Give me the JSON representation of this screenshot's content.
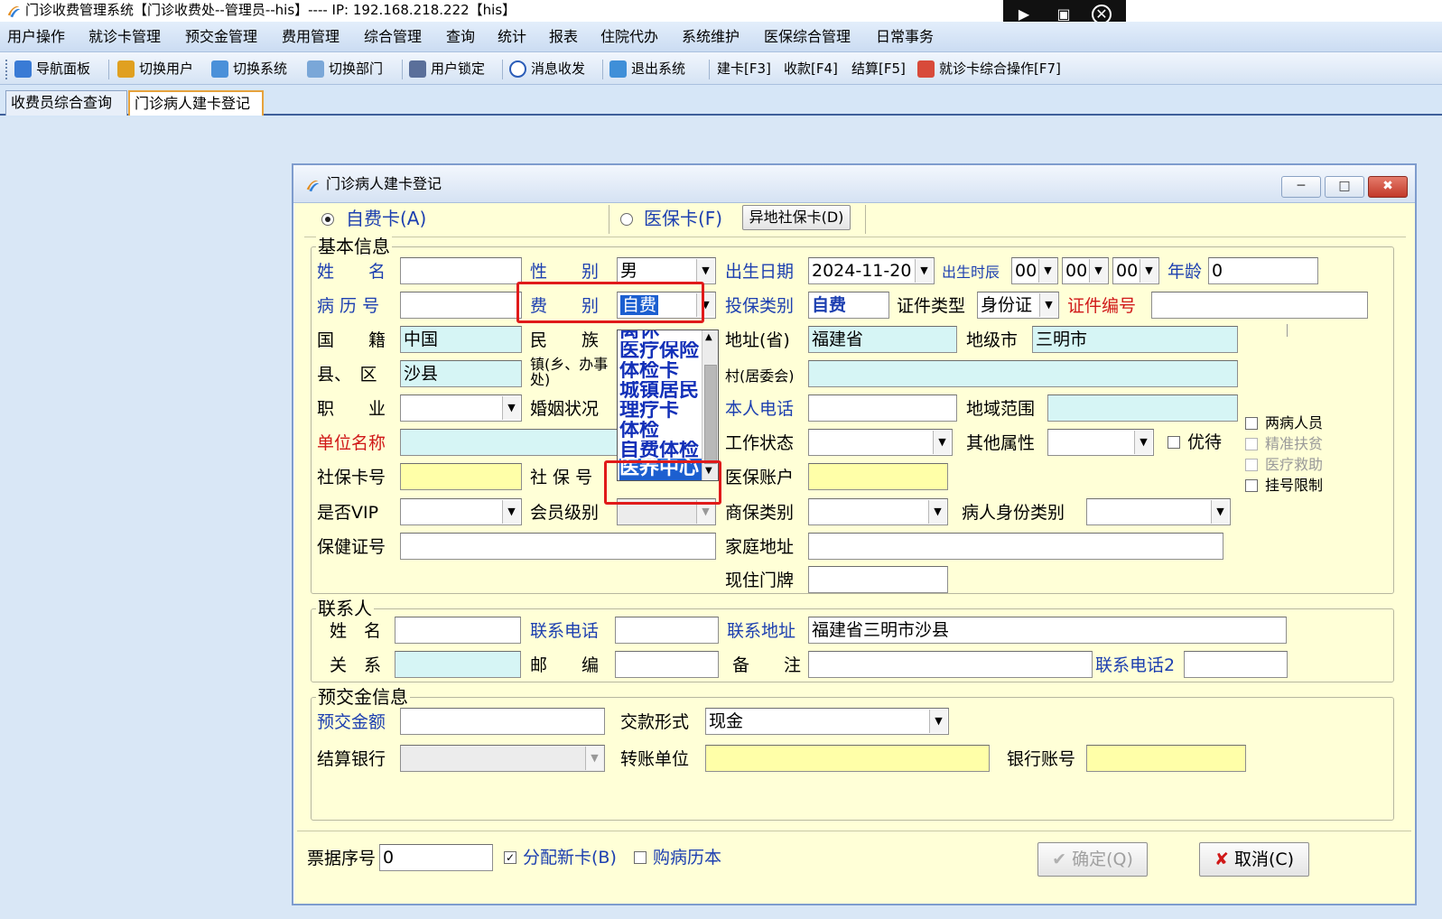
{
  "window": {
    "title": "门诊收费管理系统【门诊收费处--管理员--his】---- IP: 192.168.218.222【his】"
  },
  "menu": [
    "用户操作",
    "就诊卡管理",
    "预交金管理",
    "费用管理",
    "综合管理",
    "查询",
    "统计",
    "报表",
    "住院代办",
    "系统维护",
    "医保综合管理",
    "日常事务"
  ],
  "toolbar": {
    "nav": "导航面板",
    "switch_user": "切换用户",
    "switch_system": "切换系统",
    "switch_dept": "切换部门",
    "lock_user": "用户锁定",
    "messages": "消息收发",
    "exit": "退出系统",
    "f3": "建卡[F3]",
    "f4": "收款[F4]",
    "f5": "结算[F5]",
    "f7": "就诊卡综合操作[F7]"
  },
  "tabs": [
    "收费员综合查询",
    "门诊病人建卡登记"
  ],
  "dialog": {
    "title": "门诊病人建卡登记",
    "card_self": "自费卡(A)",
    "card_ins": "医保卡(F)",
    "remote_btn": "异地社保卡(D)",
    "basic": {
      "group": "基本信息",
      "name": "姓　　名",
      "gender": "性　　别",
      "gender_val": "男",
      "birth": "出生日期",
      "birth_val": "2024-11-20",
      "birth_time": "出生时辰",
      "hh": "00",
      "mm": "00",
      "ss": "00",
      "age": "年龄",
      "age_val": "0",
      "record_no": "病 历 号",
      "fee_type": "费　　别",
      "fee_type_val": "自费",
      "ins_cat": "投保类别",
      "ins_cat_val": "自费",
      "id_type": "证件类型",
      "id_type_val": "身份证",
      "id_no": "证件编号",
      "nationality": "国　　籍",
      "nationality_val": "中国",
      "ethnic": "民　　族",
      "prov": "地址(省)",
      "prov_val": "福建省",
      "city": "地级市",
      "city_val": "三明市",
      "county": "县、　区",
      "county_val": "沙县",
      "town": "镇(乡、办事处)",
      "village": "村(居委会)",
      "job": "职　　业",
      "marital": "婚姻状况",
      "phone": "本人电话",
      "region": "地域范围",
      "employer": "单位名称",
      "work_status": "工作状态",
      "other_attr": "其他属性",
      "priority": "优待",
      "si_card": "社保卡号",
      "si_no": "社 保 号",
      "si_no_val": "医养中心",
      "ins_acct": "医保账户",
      "vip": "是否VIP",
      "member": "会员级别",
      "com_ins": "商保类别",
      "pat_type": "病人身份类别",
      "health_no": "保健证号",
      "home_addr": "家庭地址",
      "door_no": "现住门牌",
      "chk_two": "两病人员",
      "chk_poverty": "精准扶贫",
      "chk_aid": "医疗救助",
      "chk_limit": "挂号限制"
    },
    "fee_options": [
      "离休",
      "医疗保险",
      "体检卡",
      "城镇居民",
      "理疗卡",
      "体检",
      "自费体检",
      "医养中心"
    ],
    "contact": {
      "group": "联系人",
      "name": "姓　名",
      "phone": "联系电话",
      "addr": "联系地址",
      "addr_val": "福建省三明市沙县",
      "relation": "关　系",
      "zip": "邮　　编",
      "remark": "备　　注",
      "phone2": "联系电话2"
    },
    "prepay": {
      "group": "预交金信息",
      "amount": "预交金额",
      "method": "交款形式",
      "method_val": "现金",
      "bank": "结算银行",
      "transfer": "转账单位",
      "account": "银行账号"
    },
    "footer": {
      "receipt": "票据序号",
      "receipt_val": "0",
      "assign_card": "分配新卡(B)",
      "buy_book": "购病历本",
      "ok": "确定(Q)",
      "cancel": "取消(C)"
    }
  }
}
